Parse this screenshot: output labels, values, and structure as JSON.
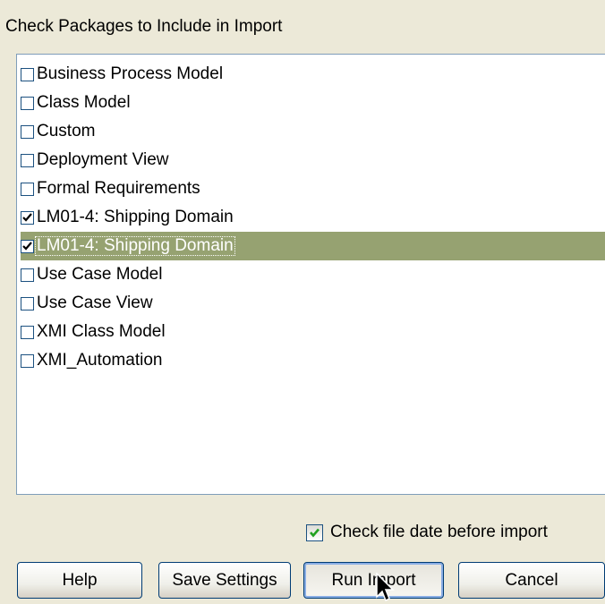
{
  "dialog": {
    "title": "Check Packages to Include in Import"
  },
  "packages": [
    {
      "label": "Business Process Model",
      "checked": false,
      "selected": false
    },
    {
      "label": "Class Model",
      "checked": false,
      "selected": false
    },
    {
      "label": "Custom",
      "checked": false,
      "selected": false
    },
    {
      "label": "Deployment View",
      "checked": false,
      "selected": false
    },
    {
      "label": "Formal Requirements",
      "checked": false,
      "selected": false
    },
    {
      "label": "LM01-4: Shipping Domain",
      "checked": true,
      "selected": false
    },
    {
      "label": "LM01-4: Shipping Domain",
      "checked": true,
      "selected": true
    },
    {
      "label": "Use Case Model",
      "checked": false,
      "selected": false
    },
    {
      "label": "Use Case View",
      "checked": false,
      "selected": false
    },
    {
      "label": "XMI Class Model",
      "checked": false,
      "selected": false
    },
    {
      "label": "XMI_Automation",
      "checked": false,
      "selected": false
    }
  ],
  "options": {
    "check_file_date_label": "Check file date before import",
    "check_file_date_checked": true
  },
  "buttons": {
    "help": "Help",
    "save_settings": "Save Settings",
    "run_import": "Run Import",
    "cancel": "Cancel"
  },
  "colors": {
    "selection": "#96a271",
    "dialog_background": "#ece9d8",
    "checkmark": "#21a121"
  },
  "icons": {
    "cursor": "arrow-cursor-icon",
    "check": "check-icon"
  }
}
